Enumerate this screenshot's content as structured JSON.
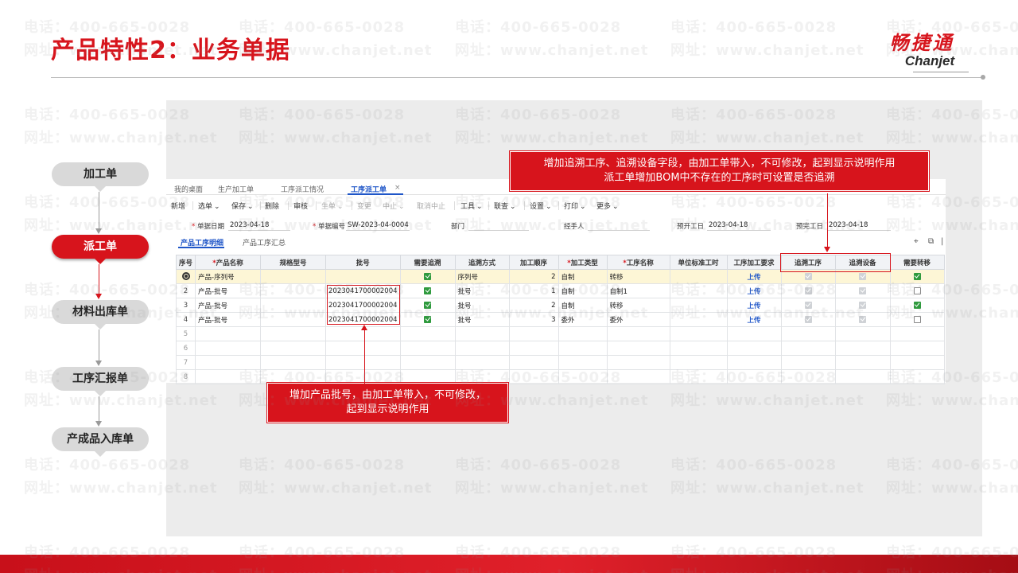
{
  "slide": {
    "title": "产品特性2：业务单据",
    "logo_cn": "畅捷通",
    "logo_en": "Chanjet",
    "watermark_phone": "电话：400-665-0028",
    "watermark_url": "网址：www.chanjet.net"
  },
  "flow": {
    "nodes": [
      "加工单",
      "派工单",
      "材料出库单",
      "工序汇报单",
      "产成品入库单"
    ],
    "active_index": 1
  },
  "app": {
    "tabs": [
      "我的桌面",
      "生产加工单",
      "工序派工情况",
      "工序派工单"
    ],
    "active_tab": "工序派工单",
    "tab_close": "×",
    "toolbar": [
      "新增",
      "选单",
      "保存",
      "删除",
      "审核",
      "生单",
      "变更",
      "中止",
      "取消中止",
      "工具",
      "联查",
      "设置",
      "打印",
      "更多"
    ],
    "toolbar_dropdown_mark": "⌄",
    "form": {
      "doc_date_label": "单据日期",
      "doc_date": "2023-04-18",
      "doc_no_label": "单据编号",
      "doc_no": "SW-2023-04-0004",
      "dept_label": "部门",
      "handler_label": "经手人",
      "plan_start_label": "预开工日",
      "plan_start": "2023-04-18",
      "plan_end_label": "预完工日",
      "plan_end": "2023-04-18"
    },
    "subtabs": [
      "产品工序明细",
      "产品工序汇总"
    ],
    "grid": {
      "headers": [
        "序号",
        "产品名称",
        "规格型号",
        "批号",
        "需要追溯",
        "追溯方式",
        "加工顺序",
        "加工类型",
        "工序名称",
        "单位标准工时",
        "工序加工要求",
        "追溯工序",
        "追溯设备",
        "需要转移"
      ],
      "required_headers": [
        1,
        7,
        8
      ],
      "rows": [
        {
          "no": "",
          "product": "产品-序列号",
          "spec": "",
          "batch": "",
          "trace": "on",
          "trace_mode": "序列号",
          "order": "2",
          "proc_type": "自制",
          "proc_name": "转移",
          "std_hours": "",
          "requirement": "上传",
          "trace_proc": "dis",
          "trace_equip": "dis",
          "transfer": "on"
        },
        {
          "no": "2",
          "product": "产品-批号",
          "spec": "",
          "batch": "2023041700002004",
          "trace": "on",
          "trace_mode": "批号",
          "order": "1",
          "proc_type": "自制",
          "proc_name": "自制1",
          "std_hours": "",
          "requirement": "上传",
          "trace_proc": "dis",
          "trace_equip": "dis",
          "transfer": "off"
        },
        {
          "no": "3",
          "product": "产品-批号",
          "spec": "",
          "batch": "2023041700002004",
          "trace": "on",
          "trace_mode": "批号",
          "order": "2",
          "proc_type": "自制",
          "proc_name": "转移",
          "std_hours": "",
          "requirement": "上传",
          "trace_proc": "dis",
          "trace_equip": "dis",
          "transfer": "on"
        },
        {
          "no": "4",
          "product": "产品-批号",
          "spec": "",
          "batch": "2023041700002004",
          "trace": "on",
          "trace_mode": "批号",
          "order": "3",
          "proc_type": "委外",
          "proc_name": "委外",
          "std_hours": "",
          "requirement": "上传",
          "trace_proc": "dis",
          "trace_equip": "dis",
          "transfer": "off"
        }
      ],
      "empty_rows": [
        "5",
        "6",
        "7",
        "8"
      ]
    }
  },
  "callouts": {
    "top": [
      "增加追溯工序、追溯设备字段，由加工单带入，不可修改，起到显示说明作用",
      "派工单增加BOM中不存在的工序时可设置是否追溯"
    ],
    "bottom": [
      "增加产品批号，由加工单带入，不可修改，",
      "起到显示说明作用"
    ]
  },
  "colors": {
    "brand_red": "#d7141c",
    "link_blue": "#1f56c8",
    "check_green": "#2f9a3e"
  }
}
